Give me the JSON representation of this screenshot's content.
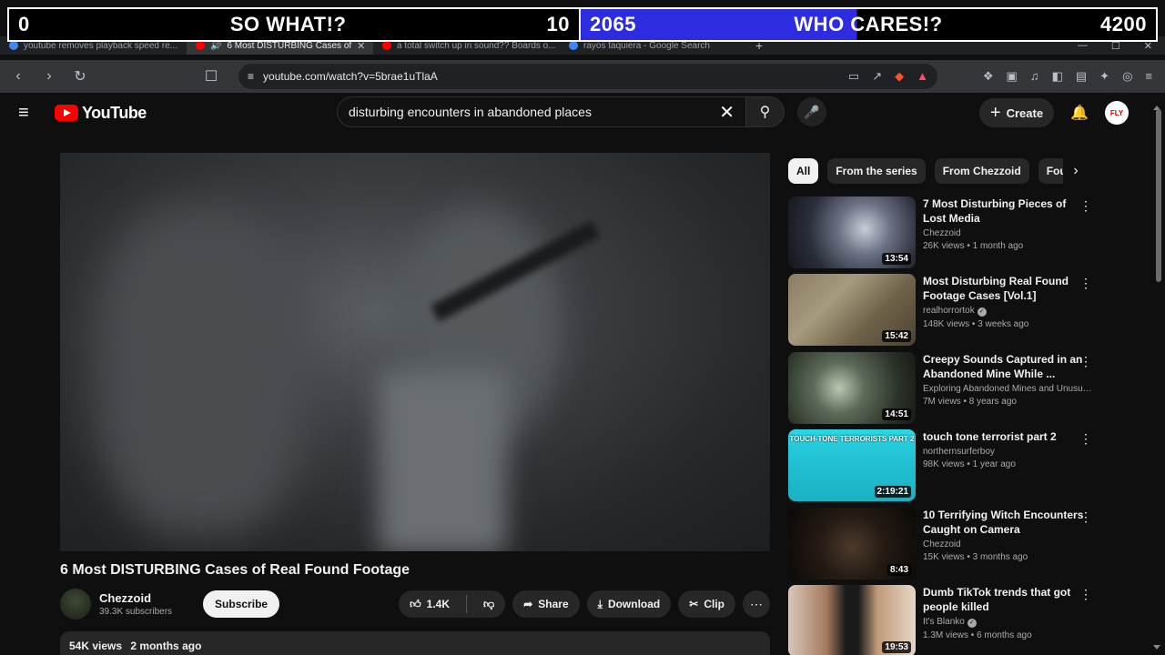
{
  "overlay": {
    "left_score": "0",
    "left_label": "SO WHAT!?",
    "left_goal": "10",
    "right_score": "2065",
    "right_label": "WHO CARES!?",
    "right_goal": "4200",
    "right_accent": "#2d2ce0"
  },
  "browser": {
    "tabs": [
      {
        "label": "youtube removes playback speed re..."
      },
      {
        "label": "6 Most DISTURBING Cases of"
      },
      {
        "label": "a total switch up in sound?? Boards o..."
      },
      {
        "label": "rayos taquiera - Google Search"
      }
    ],
    "new_tab": "+",
    "url": "youtube.com/watch?v=5brae1uTlaA"
  },
  "yt": {
    "logo_text": "YouTube",
    "search_query": "disturbing encounters in abandoned places",
    "create_label": "Create",
    "avatar_text": "FLY"
  },
  "video": {
    "title": "6 Most DISTURBING Cases of Real Found Footage",
    "channel": "Chezzoid",
    "subscribers": "39.3K subscribers",
    "subscribe_label": "Subscribe",
    "likes": "1.4K",
    "share_label": "Share",
    "download_label": "Download",
    "clip_label": "Clip",
    "views": "54K views",
    "age": "2 months ago"
  },
  "chips": [
    "All",
    "From the series",
    "From Chezzoid",
    "Found footage"
  ],
  "recommendations": [
    {
      "title": "7 Most Disturbing Pieces of Lost Media",
      "channel": "Chezzoid",
      "verified": false,
      "stats": "26K views • 1 month ago",
      "duration": "13:54",
      "thumb": "t1"
    },
    {
      "title": "Most Disturbing Real Found Footage Cases [Vol.1]",
      "channel": "realhorrortok",
      "verified": true,
      "stats": "148K views • 3 weeks ago",
      "duration": "15:42",
      "thumb": "t2"
    },
    {
      "title": "Creepy Sounds Captured in an Abandoned Mine While ...",
      "channel": "Exploring Abandoned Mines and Unusua...",
      "verified": false,
      "stats": "7M views • 8 years ago",
      "duration": "14:51",
      "thumb": "t3"
    },
    {
      "title": "touch tone terrorist part 2",
      "channel": "northernsurferboy",
      "verified": false,
      "stats": "98K views • 1 year ago",
      "duration": "2:19:21",
      "thumb": "t4",
      "band": "TOUCH-TONE TERRORISTS PART 2"
    },
    {
      "title": "10 Terrifying Witch Encounters Caught on Camera",
      "channel": "Chezzoid",
      "verified": false,
      "stats": "15K views • 3 months ago",
      "duration": "8:43",
      "thumb": "t5"
    },
    {
      "title": "Dumb TikTok trends that got people killed",
      "channel": "It's Blanko",
      "verified": true,
      "stats": "1.3M views • 6 months ago",
      "duration": "19:53",
      "thumb": "t6"
    }
  ]
}
